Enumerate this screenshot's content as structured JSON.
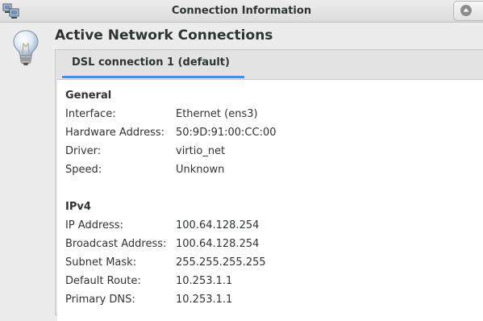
{
  "window": {
    "title": "Connection Information"
  },
  "heading": "Active Network Connections",
  "tabs": [
    {
      "label": "DSL connection 1 (default)",
      "active": true
    }
  ],
  "general": {
    "title": "General",
    "rows": [
      {
        "label": "Interface:",
        "value": "Ethernet (ens3)"
      },
      {
        "label": "Hardware Address:",
        "value": "50:9D:91:00:CC:00"
      },
      {
        "label": "Driver:",
        "value": "virtio_net"
      },
      {
        "label": "Speed:",
        "value": "Unknown"
      }
    ]
  },
  "ipv4": {
    "title": "IPv4",
    "rows": [
      {
        "label": "IP Address:",
        "value": "100.64.128.254"
      },
      {
        "label": "Broadcast Address:",
        "value": "100.64.128.254"
      },
      {
        "label": "Subnet Mask:",
        "value": "255.255.255.255"
      },
      {
        "label": "Default Route:",
        "value": "10.253.1.1"
      },
      {
        "label": "Primary DNS:",
        "value": "10.253.1.1"
      }
    ]
  },
  "icons": {
    "window": "network-computers-icon",
    "info": "lightbulb-icon",
    "window_button": "arrow-up-icon"
  },
  "colors": {
    "tab_accent": "#4a90d9",
    "titlebar": "#e4e4e4",
    "page_background": "#ffffff"
  }
}
